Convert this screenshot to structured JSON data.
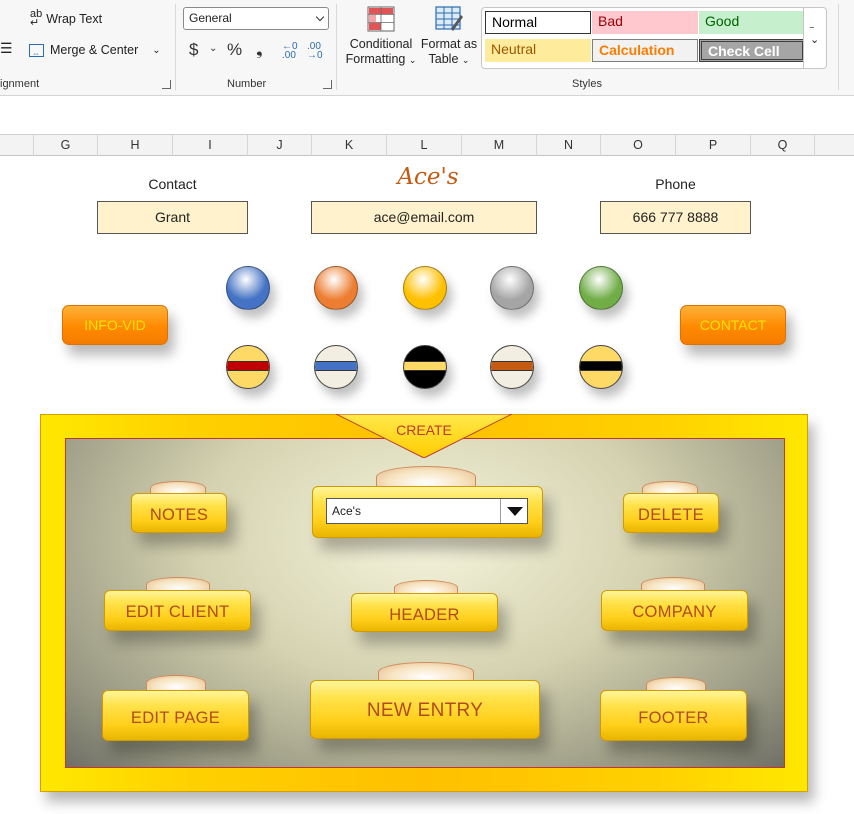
{
  "ribbon": {
    "alignment": {
      "wrap_text": "Wrap Text",
      "merge_center": "Merge & Center",
      "group_label": "ignment"
    },
    "number": {
      "format_value": "General",
      "currency_symbol": "$",
      "percent_symbol": "%",
      "comma_symbol": "❟",
      "group_label": "Number"
    },
    "conditional_formatting": {
      "line1": "Conditional",
      "line2": "Formatting"
    },
    "format_as_table": {
      "line1": "Format as",
      "line2": "Table"
    },
    "styles": {
      "group_label": "Styles",
      "cells": [
        {
          "label": "Normal",
          "bg": "#ffffff",
          "color": "#000000"
        },
        {
          "label": "Bad",
          "bg": "#ffc7ce",
          "color": "#9c0006"
        },
        {
          "label": "Good",
          "bg": "#c6efce",
          "color": "#006100"
        },
        {
          "label": "Neutral",
          "bg": "#ffeb9c",
          "color": "#9c5700"
        },
        {
          "label": "Calculation",
          "bg": "#f2f2f2",
          "color": "#fa7d00"
        },
        {
          "label": "Check Cell",
          "bg": "#a5a5a5",
          "color": "#ffffff"
        }
      ]
    }
  },
  "columns": [
    "G",
    "H",
    "I",
    "J",
    "K",
    "L",
    "M",
    "N",
    "O",
    "P",
    "Q"
  ],
  "sheet": {
    "contact_label": "Contact",
    "title": "Ace's",
    "phone_label": "Phone",
    "contact_value": "Grant",
    "email_value": "ace@email.com",
    "phone_value": "666 777 8888",
    "info_vid_button": "INFO-VID",
    "contact_button": "CONTACT",
    "swatches_solid": [
      "#4472c4",
      "#ed7d31",
      "#ffc000",
      "#a5a5a5",
      "#70ad47"
    ],
    "swatches_banded": [
      {
        "bg": "#ffd966",
        "band": "#c00000"
      },
      {
        "bg": "#f2efe2",
        "band": "#4472c4"
      },
      {
        "bg": "#000000",
        "band": "#ffd966"
      },
      {
        "bg": "#f2efe2",
        "band": "#c55a11"
      },
      {
        "bg": "#ffd966",
        "band": "#000000"
      }
    ]
  },
  "panel": {
    "create_label": "CREATE",
    "client_select": "Ace's",
    "buttons": {
      "notes": "NOTES",
      "delete": "DELETE",
      "edit_client": "EDIT CLIENT",
      "header": "HEADER",
      "company": "COMPANY",
      "edit_page": "EDIT PAGE",
      "new_entry": "NEW ENTRY",
      "footer": "FOOTER"
    }
  }
}
